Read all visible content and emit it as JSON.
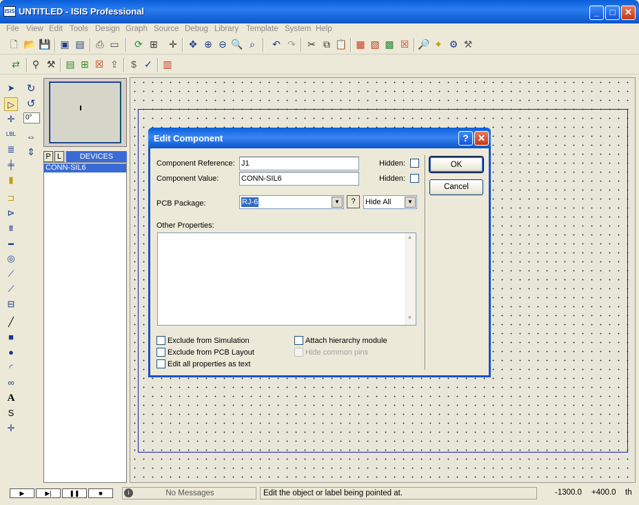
{
  "window": {
    "title": "UNTITLED - ISIS Professional",
    "app_icon": "ISIS"
  },
  "menu": [
    "File",
    "View",
    "Edit",
    "Tools",
    "Design",
    "Graph",
    "Source",
    "Debug",
    "Library",
    "Template",
    "System",
    "Help"
  ],
  "rotation": {
    "angle_value": "0°"
  },
  "device_panel": {
    "p_label": "P",
    "l_label": "L",
    "header": "DEVICES",
    "items": [
      "CONN-SIL6"
    ]
  },
  "status": {
    "messages": "No Messages",
    "hint": "Edit the object or label being pointed at.",
    "x": "-1300.0",
    "y": "+400.0",
    "unit": "th"
  },
  "dialog": {
    "title": "Edit Component",
    "reference_label": "Component Reference:",
    "reference_value": "J1",
    "value_label": "Component Value:",
    "value_value": "CONN-SIL6",
    "hidden_label": "Hidden:",
    "pcb_label": "PCB Package:",
    "pcb_value": "RJ-6",
    "pcb_help": "?",
    "hide_value": "Hide All",
    "other_label": "Other Properties:",
    "ok_label": "OK",
    "cancel_label": "Cancel",
    "checks": {
      "exclude_sim": "Exclude from Simulation",
      "exclude_pcb": "Exclude from PCB Layout",
      "edit_all": "Edit all properties as text",
      "attach": "Attach hierarchy module",
      "hide_pins": "Hide common pins"
    }
  }
}
